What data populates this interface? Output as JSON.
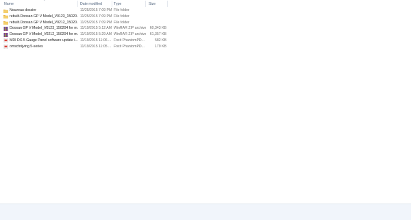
{
  "columns": {
    "name": "Name",
    "date_modified": "Date modified",
    "type": "Type",
    "size": "Size"
  },
  "files": [
    {
      "name": "Nouveau dossier",
      "date": "11/25/2015 7:09 PM",
      "type": "File folder",
      "size": "",
      "icon": "folder-icon",
      "icon_color": "#e8b84a"
    },
    {
      "name": "rebuilt.Doosan GP V Model_V0123_15020...",
      "date": "11/25/2015 7:09 PM",
      "type": "File folder",
      "size": "",
      "icon": "folder-icon",
      "icon_color": "#e8b84a"
    },
    {
      "name": "rebuilt.Doosan GP V Model_V0212_15020...",
      "date": "11/25/2015 7:09 PM",
      "type": "File folder",
      "size": "",
      "icon": "folder-icon",
      "icon_color": "#e8b84a"
    },
    {
      "name": "Doosan GP V Model_V0123_150204 for m...",
      "date": "11/19/2015 5:12 AM",
      "type": "WinRAR ZIP archive",
      "size": "60,343 KB",
      "icon": "winrar-zip-icon",
      "icon_color": "#8a3f8f"
    },
    {
      "name": "Doosan GP V Model_V0212_150204 for m...",
      "date": "11/19/2015 5:29 AM",
      "type": "WinRAR ZIP archive",
      "size": "61,357 KB",
      "icon": "winrar-zip-icon",
      "icon_color": "#8a3f8f"
    },
    {
      "name": "MDI DX-5 Gauge Panel software update i...",
      "date": "11/19/2015 11:06 ...",
      "type": "Foxit PhantomPD...",
      "size": "582 KB",
      "icon": "pdf-icon",
      "icon_color": "#d8433b"
    },
    {
      "name": "omschrijving 5-series",
      "date": "11/19/2015 11:05 ...",
      "type": "Foxit PhantomPD...",
      "size": "179 KB",
      "icon": "pdf-icon",
      "icon_color": "#d8433b"
    }
  ]
}
